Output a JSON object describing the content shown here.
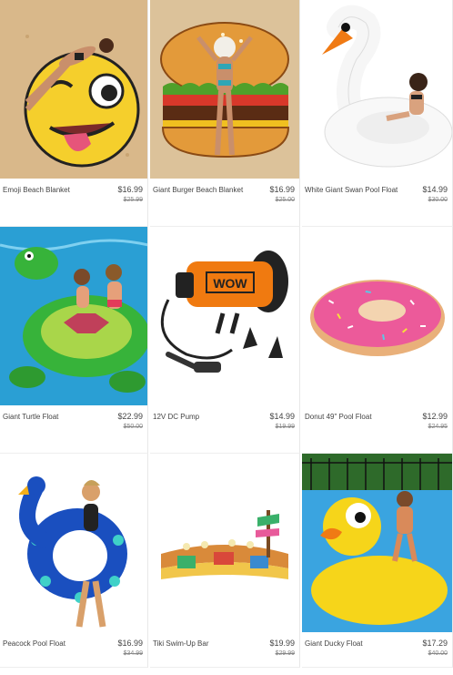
{
  "products": [
    {
      "name": "Emoji Beach Blanket",
      "price": "$16.99",
      "old_price": "$25.99"
    },
    {
      "name": "Giant Burger Beach Blanket",
      "price": "$16.99",
      "old_price": "$25.00"
    },
    {
      "name": "White Giant Swan Pool Float",
      "price": "$14.99",
      "old_price": "$30.00"
    },
    {
      "name": "Giant Turtle Float",
      "price": "$22.99",
      "old_price": "$50.00"
    },
    {
      "name": "12V DC Pump",
      "price": "$14.99",
      "old_price": "$19.99"
    },
    {
      "name": "Donut 49\" Pool Float",
      "price": "$12.99",
      "old_price": "$24.95"
    },
    {
      "name": "Peacock Pool Float",
      "price": "$16.99",
      "old_price": "$34.99"
    },
    {
      "name": "Tiki Swim-Up Bar",
      "price": "$19.99",
      "old_price": "$29.99"
    },
    {
      "name": "Giant Ducky Float",
      "price": "$17.29",
      "old_price": "$40.00"
    }
  ],
  "pump_brand": "WOW"
}
